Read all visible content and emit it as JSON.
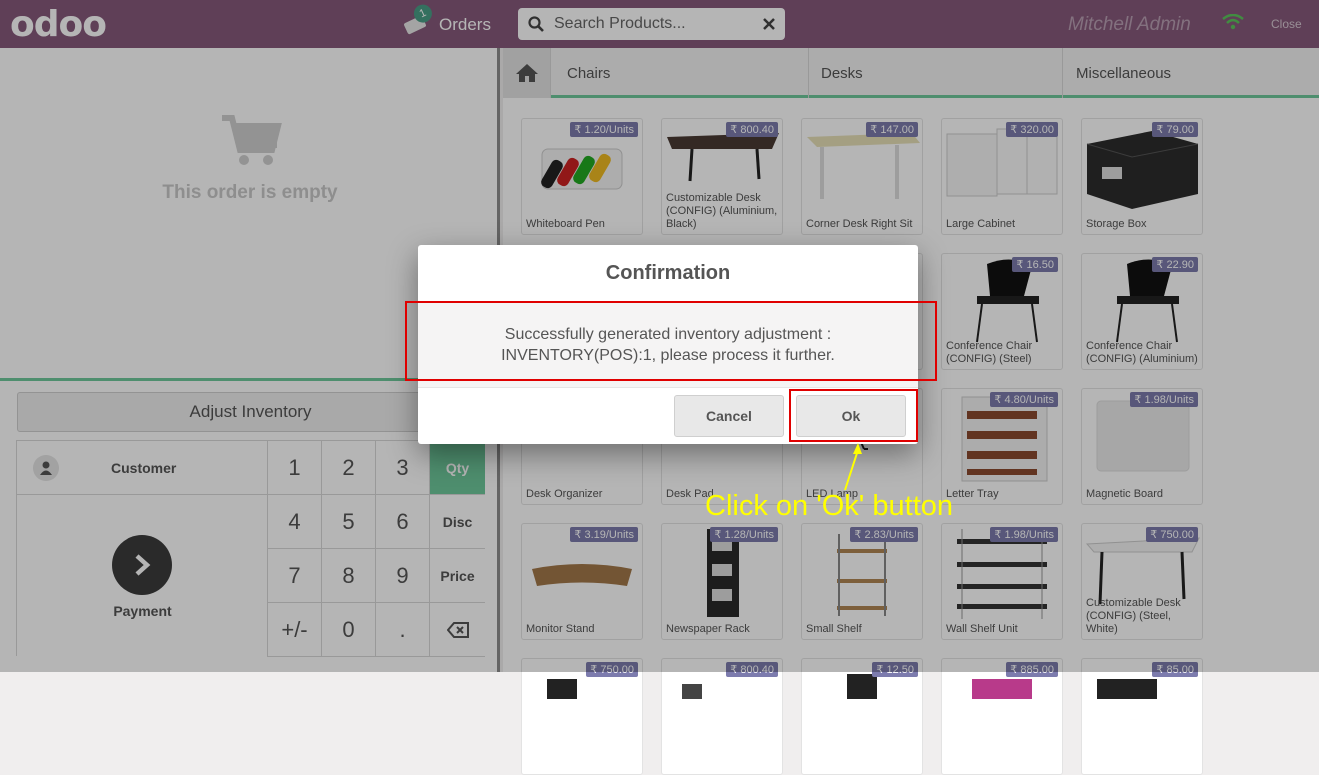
{
  "header": {
    "logo": "odoo",
    "orders_label": "Orders",
    "orders_count": "1",
    "search_placeholder": "Search Products...",
    "user": "Mitchell Admin",
    "close_label": "Close"
  },
  "order": {
    "empty_text": "This order is empty",
    "adjust_inventory_label": "Adjust Inventory"
  },
  "numpad": {
    "customer_label": "Customer",
    "payment_label": "Payment",
    "keys": [
      "1",
      "2",
      "3",
      "4",
      "5",
      "6",
      "7",
      "8",
      "9",
      "+/-",
      "0",
      "."
    ],
    "modes": [
      "Qty",
      "Disc",
      "Price"
    ],
    "selected_mode": "Qty"
  },
  "categories": [
    "Chairs",
    "Desks",
    "Miscellaneous"
  ],
  "products": [
    {
      "name": "Whiteboard Pen",
      "price": "₹ 1.20/Units"
    },
    {
      "name": "Customizable Desk (CONFIG) (Aluminium, Black)",
      "price": "₹ 800.40"
    },
    {
      "name": "Corner Desk Right Sit",
      "price": "₹ 147.00"
    },
    {
      "name": "Large Cabinet",
      "price": "₹ 320.00"
    },
    {
      "name": "Storage Box",
      "price": "₹ 79.00"
    },
    {
      "name": "",
      "price": ""
    },
    {
      "name": "",
      "price": ""
    },
    {
      "name": "",
      "price": ""
    },
    {
      "name": "Conference Chair (CONFIG) (Steel)",
      "price": "₹ 16.50"
    },
    {
      "name": "Conference Chair (CONFIG) (Aluminium)",
      "price": "₹ 22.90"
    },
    {
      "name": "Desk Organizer",
      "price": ""
    },
    {
      "name": "Desk Pad",
      "price": ""
    },
    {
      "name": "LED Lamp",
      "price": ""
    },
    {
      "name": "Letter Tray",
      "price": "₹ 4.80/Units"
    },
    {
      "name": "Magnetic Board",
      "price": "₹ 1.98/Units"
    },
    {
      "name": "Monitor Stand",
      "price": "₹ 3.19/Units"
    },
    {
      "name": "Newspaper Rack",
      "price": "₹ 1.28/Units"
    },
    {
      "name": "Small Shelf",
      "price": "₹ 2.83/Units"
    },
    {
      "name": "Wall Shelf Unit",
      "price": "₹ 1.98/Units"
    },
    {
      "name": "Customizable Desk (CONFIG) (Steel, White)",
      "price": "₹ 750.00"
    },
    {
      "name": "",
      "price": "₹ 750.00"
    },
    {
      "name": "",
      "price": "₹ 800.40"
    },
    {
      "name": "",
      "price": "₹ 12.50"
    },
    {
      "name": "",
      "price": "₹ 885.00"
    },
    {
      "name": "",
      "price": "₹ 85.00"
    }
  ],
  "dialog": {
    "title": "Confirmation",
    "message_line1": "Successfully generated inventory adjustment :",
    "message_line2": "INVENTORY(POS):1, please process it further.",
    "cancel_label": "Cancel",
    "ok_label": "Ok"
  },
  "annotation": {
    "text": "Click on 'Ok' button",
    "color": "#ffff00"
  },
  "colors": {
    "brand": "#875a7b",
    "accent": "#6ec89b",
    "price_badge": "#7c7bad",
    "highlight": "#e00000"
  }
}
